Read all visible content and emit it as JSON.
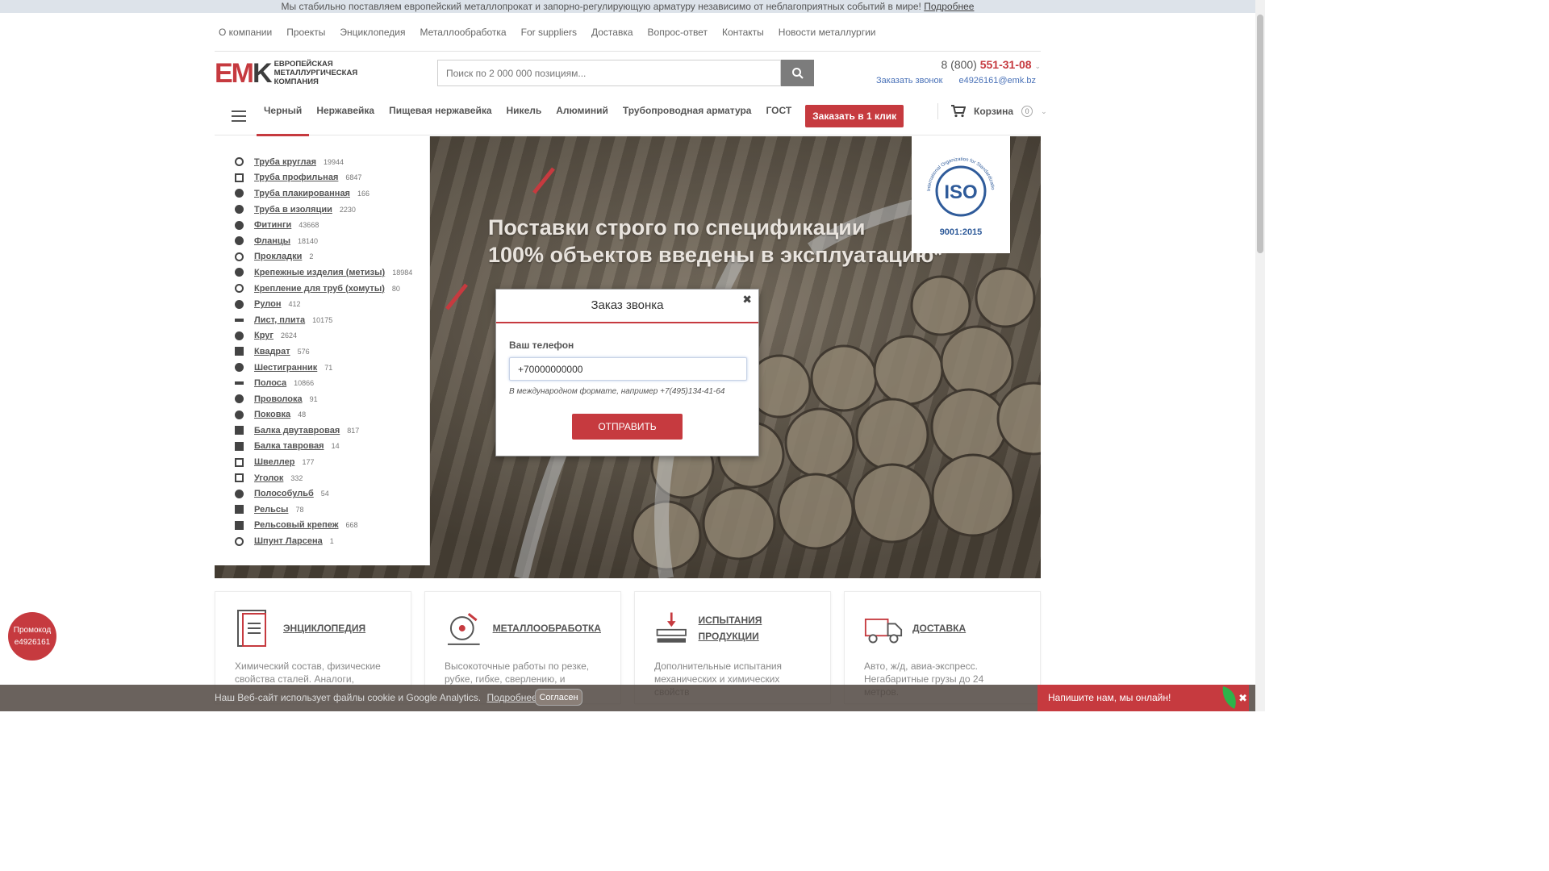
{
  "notice": {
    "text": "Мы стабильно поставляем европейский металлопрокат и запорно-регулирующую арматуру независимо от неблагоприятных событий в мире!",
    "link": "Подробнее"
  },
  "topnav": [
    "О компании",
    "Проекты",
    "Энциклопедия",
    "Металлообработка",
    "For suppliers",
    "Доставка",
    "Вопрос-ответ",
    "Контакты",
    "Новости металлургии"
  ],
  "logo": {
    "mark": "EMK",
    "line1": "Европейская",
    "line2": "металлургическая",
    "line3": "компания"
  },
  "search": {
    "placeholder": "Поиск по 2 000 000 позициям..."
  },
  "contact": {
    "phone_prefix": "8 (800) ",
    "phone_main": "551-31-08",
    "callback": "Заказать звонок",
    "email": "e4926161@emk.bz"
  },
  "mainnav": {
    "items": [
      "Черный",
      "Нержавейка",
      "Пищевая нержавейка",
      "Никель",
      "Алюминий",
      "Трубопроводная арматура",
      "ГОСТ"
    ],
    "order": "Заказать в 1 клик"
  },
  "cart": {
    "label": "Корзина",
    "count": "0"
  },
  "catalog": [
    {
      "name": "Труба круглая",
      "count": "19944",
      "icon": "ring"
    },
    {
      "name": "Труба профильная",
      "count": "6847",
      "icon": "square-o"
    },
    {
      "name": "Труба плакированная",
      "count": "166",
      "icon": "circle"
    },
    {
      "name": "Труба в изоляции",
      "count": "2230",
      "icon": "circle"
    },
    {
      "name": "Фитинги",
      "count": "43668",
      "icon": "circle"
    },
    {
      "name": "Фланцы",
      "count": "18140",
      "icon": "circle"
    },
    {
      "name": "Прокладки",
      "count": "2",
      "icon": "ring"
    },
    {
      "name": "Крепежные изделия (метизы)",
      "count": "18984",
      "icon": "circle"
    },
    {
      "name": "Крепление для труб (хомуты)",
      "count": "80",
      "icon": "ring"
    },
    {
      "name": "Рулон",
      "count": "412",
      "icon": "circle"
    },
    {
      "name": "Лист, плита",
      "count": "10175",
      "icon": "bar"
    },
    {
      "name": "Круг",
      "count": "2624",
      "icon": "circle"
    },
    {
      "name": "Квадрат",
      "count": "576",
      "icon": "square"
    },
    {
      "name": "Шестигранник",
      "count": "71",
      "icon": "circle"
    },
    {
      "name": "Полоса",
      "count": "10866",
      "icon": "bar"
    },
    {
      "name": "Проволока",
      "count": "91",
      "icon": "circle"
    },
    {
      "name": "Поковка",
      "count": "48",
      "icon": "circle"
    },
    {
      "name": "Балка двутавровая",
      "count": "817",
      "icon": "square"
    },
    {
      "name": "Балка тавровая",
      "count": "14",
      "icon": "square"
    },
    {
      "name": "Швеллер",
      "count": "177",
      "icon": "square-o"
    },
    {
      "name": "Уголок",
      "count": "332",
      "icon": "square-o"
    },
    {
      "name": "Полособульб",
      "count": "54",
      "icon": "circle"
    },
    {
      "name": "Рельсы",
      "count": "78",
      "icon": "square"
    },
    {
      "name": "Рельсовый крепеж",
      "count": "668",
      "icon": "square"
    },
    {
      "name": "Шпунт Ларсена",
      "count": "1",
      "icon": "ring"
    }
  ],
  "catalog_alt": "Шестигранник",
  "hero": {
    "line1": "Поставки строго по спецификации",
    "line2": "100% объектов введены в эксплуатацию*",
    "iso_text": "ISO",
    "iso_sub": "9001:2015",
    "iso_ring": "International Organization for Standardization"
  },
  "modal": {
    "title": "Заказ звонка",
    "label": "Ваш телефон",
    "value": "+70000000000",
    "hint": "В международном формате, например +7(495)134-41-64",
    "submit": "ОТПРАВИТЬ"
  },
  "cards": [
    {
      "title": "ЭНЦИКЛОПЕДИЯ",
      "desc": "Химический состав, физические свойства сталей. Аналоги,"
    },
    {
      "title": "МЕТАЛЛООБРАБОТКА",
      "desc": "Высокоточные работы по резке, рубке, гибке, сверлению, и"
    },
    {
      "title": "ИСПЫТАНИЯ ПРОДУКЦИИ",
      "desc": "Дополнительные испытания механических и химических свойств"
    },
    {
      "title": "ДОСТАВКА",
      "desc": "Авто, ж/д, авиа-экспресс. Негабаритные грузы до 24 метров."
    }
  ],
  "promo": {
    "line1": "Промокод",
    "line2": "e4926161"
  },
  "cookie": {
    "text": "Наш Веб-сайт использует файлы cookie и Google Analytics.",
    "link": "Подробнее",
    "button": "Согласен"
  },
  "chat": {
    "text": "Напишите нам, мы онлайн!"
  },
  "colors": {
    "brand_red": "#c63a3f",
    "link_blue": "#4a72b8"
  }
}
